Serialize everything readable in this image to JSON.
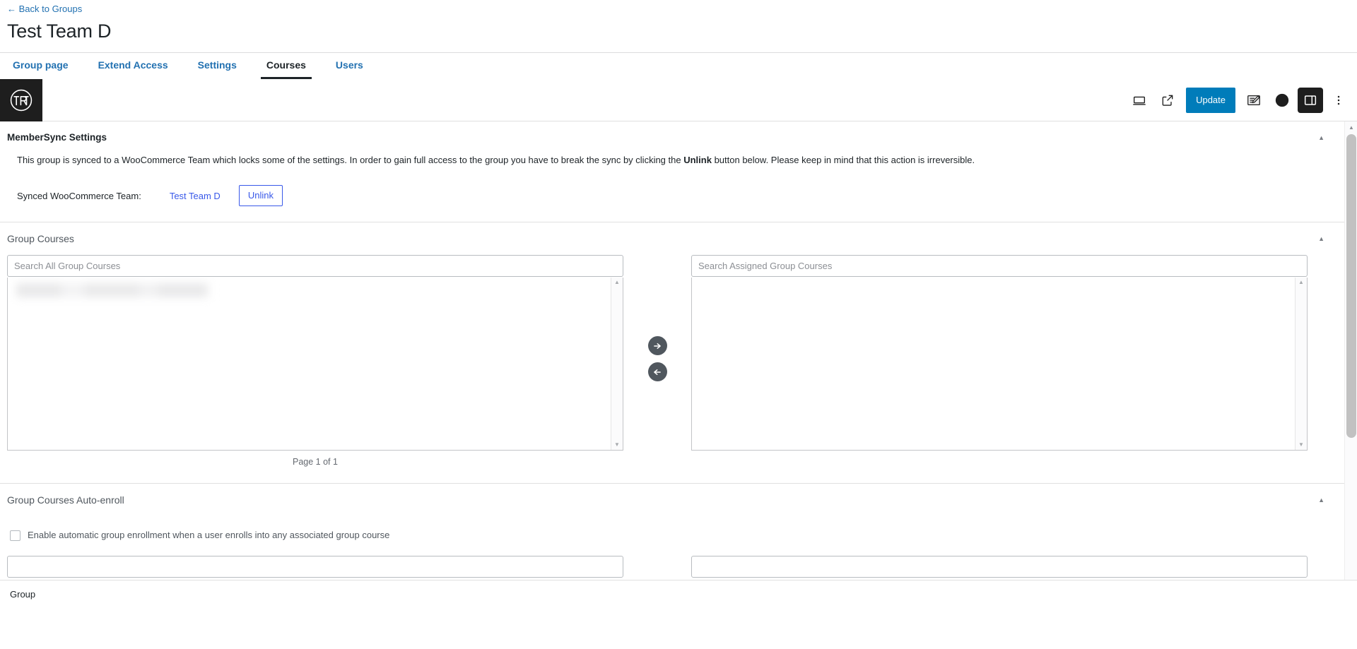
{
  "header": {
    "back_link": "← Back to Groups",
    "title": "Test Team D",
    "tabs": [
      {
        "label": "Group page",
        "active": false
      },
      {
        "label": "Extend Access",
        "active": false
      },
      {
        "label": "Settings",
        "active": false
      },
      {
        "label": "Courses",
        "active": true
      },
      {
        "label": "Users",
        "active": false
      }
    ]
  },
  "adminbar": {
    "logo_icon": "wordpress-logo-icon",
    "view_icon": "view-device-icon",
    "preview_icon": "external-link-preview-icon",
    "update_label": "Update",
    "editor_icon": "document-edit-icon",
    "jetpack_icon": "jetpack-icon",
    "sidebar_icon": "settings-sidebar-icon",
    "options_icon": "more-options-vertical-icon",
    "accent_blue": "#007cba",
    "dark": "#1e1e1e"
  },
  "panels": {
    "membersync": {
      "title": "MemberSync Settings",
      "collapse_icon": "chevron-up-icon",
      "description_before": "This group is synced to a WooCommerce Team which locks some of the settings. In order to gain full access to the group you have to break the sync by clicking the ",
      "description_bold": "Unlink",
      "description_after": " button below. Please keep in mind that this action is irreversible.",
      "sync_label": "Synced WooCommerce Team:",
      "team_link": "Test Team D",
      "unlink_label": "Unlink",
      "link_color": "#3858e9"
    },
    "group_courses": {
      "title": "Group Courses",
      "collapse_icon": "chevron-up-icon",
      "left_search_placeholder": "Search All Group Courses",
      "right_search_placeholder": "Search Assigned Group Courses",
      "left_search_value": "",
      "right_search_value": "",
      "left_items": [
        {
          "label": "",
          "redacted": true
        }
      ],
      "right_items": [],
      "move_right_icon": "arrow-right-circle-icon",
      "move_left_icon": "arrow-left-circle-icon",
      "page_count": "Page 1 of 1",
      "scroll_up_icon": "scroll-up-arrow-icon",
      "scroll_down_icon": "scroll-down-arrow-icon"
    },
    "auto_enroll": {
      "title": "Group Courses Auto-enroll",
      "collapse_icon": "chevron-up-icon",
      "checkbox_label": "Enable automatic group enrollment when a user enrolls into any associated group course",
      "checkbox_checked": false,
      "left_search_placeholder": "",
      "right_search_placeholder": ""
    }
  },
  "statusbar": {
    "label": "Group"
  },
  "scrollbar": {
    "up_icon": "scrollbar-up-icon",
    "down_icon": "scrollbar-down-icon"
  }
}
